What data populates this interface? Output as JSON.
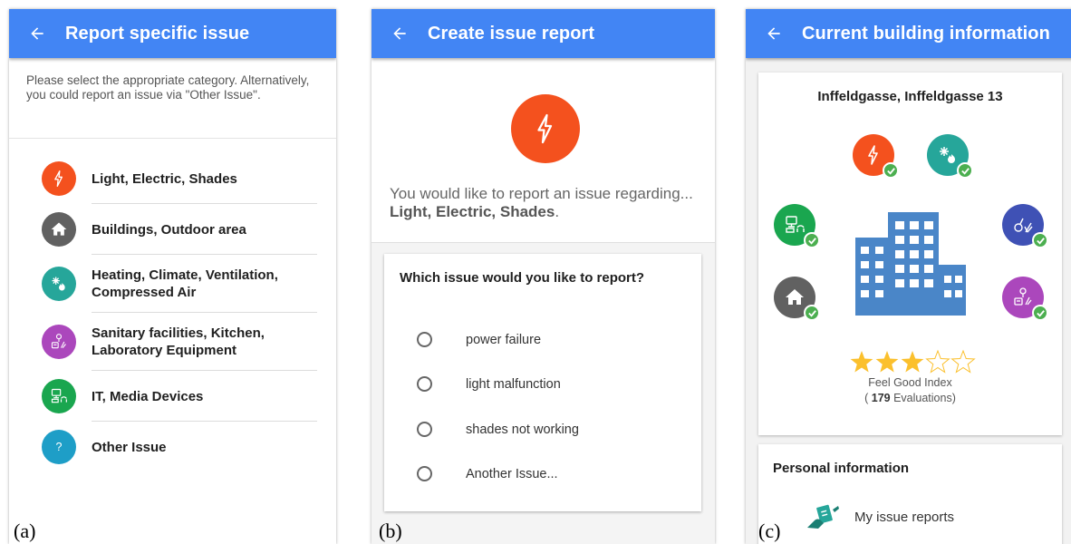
{
  "colors": {
    "appbar": "#4285f4",
    "light_electric": "#f4511e",
    "buildings": "#616161",
    "heating": "#26a69a",
    "sanitary": "#ab47bc",
    "it_media": "#1aa64f",
    "other": "#1e9ec7",
    "cleaning": "#3f51b5",
    "check": "#4caf50",
    "star": "#fbc02d"
  },
  "panel_a": {
    "title": "Report specific issue",
    "back_icon": "arrow-left-icon",
    "intro": "Please select the appropriate category. Alternatively, you could report an issue via \"Other Issue\".",
    "categories": [
      {
        "label": "Light, Electric, Shades",
        "icon": "lightning-icon"
      },
      {
        "label": "Buildings, Outdoor area",
        "icon": "house-icon"
      },
      {
        "label": "Heating, Climate, Ventilation, Compressed Air",
        "icon": "snowflake-flame-icon"
      },
      {
        "label": "Sanitary facilities, Kitchen, Laboratory Equipment",
        "icon": "sanitary-icon"
      },
      {
        "label": "IT, Media Devices",
        "icon": "computer-icon"
      },
      {
        "label": "Other Issue",
        "icon": "question-icon"
      }
    ],
    "caption": "(a)"
  },
  "panel_b": {
    "title": "Create issue report",
    "back_icon": "arrow-left-icon",
    "prompt": "You would like to report an issue regarding...",
    "category": "Light, Electric, Shades",
    "category_suffix": ".",
    "question": "Which issue would you like to report?",
    "options": [
      "power failure",
      "light malfunction",
      "shades not working",
      "Another Issue..."
    ],
    "caption": "(b)"
  },
  "panel_c": {
    "title": "Current building information",
    "back_icon": "arrow-left-icon",
    "building_name": "Inffeldgasse, Inffeldgasse 13",
    "rating": 3,
    "rating_max": 5,
    "feel_good_label": "Feel Good Index",
    "evaluations_open": "( ",
    "evaluations_count": "179",
    "evaluations_close": " Evaluations)",
    "personal_title": "Personal information",
    "my_reports": "My issue reports",
    "caption": "(c)"
  }
}
